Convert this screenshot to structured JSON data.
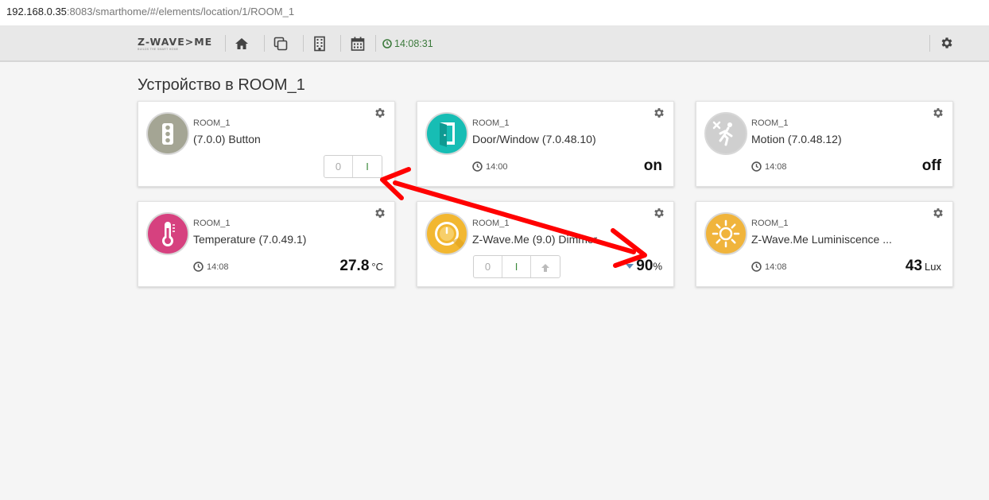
{
  "browser": {
    "url_host": "192.168.0.35",
    "url_rest": ":8083/smarthome/#/elements/location/1/ROOM_1"
  },
  "navbar": {
    "logo_text": "Z-WAVE>ME",
    "logo_tagline": "BUILDS THE SMART HOME",
    "icons": [
      "home-icon",
      "copy-icon",
      "building-icon",
      "calendar-icon"
    ],
    "time": "14:08:31",
    "settings_icon": "gear-icon",
    "time_color": "#3c7a3c"
  },
  "page": {
    "title": "Устройство в ROOM_1"
  },
  "devices": [
    {
      "room": "ROOM_1",
      "name": "(7.0.0) Button",
      "icon": "traffic-light-icon",
      "switch": [
        "0",
        "I"
      ]
    },
    {
      "room": "ROOM_1",
      "name": "Door/Window (7.0.48.10)",
      "icon": "door-icon",
      "time": "14:00",
      "level": "on"
    },
    {
      "room": "ROOM_1",
      "name": "Motion (7.0.48.12)",
      "icon": "motion-icon",
      "time": "14:08",
      "level": "off"
    },
    {
      "room": "ROOM_1",
      "name": "Temperature (7.0.49.1)",
      "icon": "thermometer-icon",
      "time": "14:08",
      "level": "27.8",
      "unit": "°C"
    },
    {
      "room": "ROOM_1",
      "name": "Z-Wave.Me (9.0) Dimmer",
      "icon": "dimmer-icon",
      "switch": [
        "0",
        "I"
      ],
      "level": "90",
      "unit": "%"
    },
    {
      "room": "ROOM_1",
      "name": "Z-Wave.Me Luminiscence ...",
      "icon": "sun-icon",
      "time": "14:08",
      "level": "43",
      "unit": "Lux"
    }
  ],
  "annotation": {
    "arrow_color": "#ff0000"
  }
}
